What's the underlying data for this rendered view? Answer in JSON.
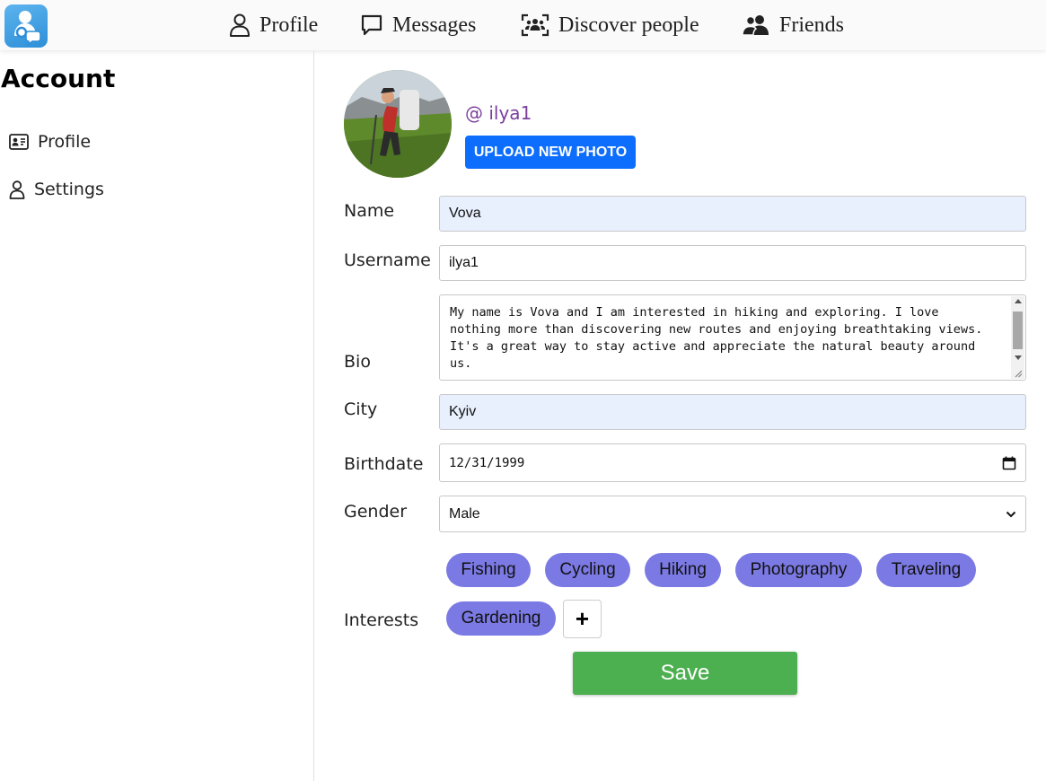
{
  "nav": {
    "items": [
      {
        "label": "Profile",
        "icon": "person-icon"
      },
      {
        "label": "Messages",
        "icon": "chat-bubble-icon"
      },
      {
        "label": "Discover people",
        "icon": "people-scan-icon"
      },
      {
        "label": "Friends",
        "icon": "people-icon"
      }
    ]
  },
  "sidebar": {
    "title": "Account",
    "items": [
      {
        "label": "Profile",
        "icon": "id-card-icon"
      },
      {
        "label": "Settings",
        "icon": "person-outline-icon"
      }
    ]
  },
  "profile": {
    "handle": "@ ilya1",
    "upload_label": "UPLOAD NEW PHOTO"
  },
  "form": {
    "name": {
      "label": "Name",
      "value": "Vova"
    },
    "username": {
      "label": "Username",
      "value": "ilya1"
    },
    "bio": {
      "label": "Bio",
      "value": "My name is Vova and I am interested in hiking and exploring. I love nothing more than discovering new routes and enjoying breathtaking views. It's a great way to stay active and appreciate the natural beauty around us."
    },
    "city": {
      "label": "City",
      "value": "Kyiv"
    },
    "birthdate": {
      "label": "Birthdate",
      "value": "12/31/1999"
    },
    "gender": {
      "label": "Gender",
      "value": "Male"
    },
    "interests": {
      "label": "Interests",
      "items": [
        "Fishing",
        "Cycling",
        "Hiking",
        "Photography",
        "Traveling",
        "Gardening"
      ],
      "add_label": "+"
    },
    "save_label": "Save"
  },
  "colors": {
    "accent": "#0d6efd",
    "chip": "#7b79e3",
    "save": "#4caf50",
    "handle": "#7b3f9e",
    "filled_field": "#e8f0fe"
  }
}
